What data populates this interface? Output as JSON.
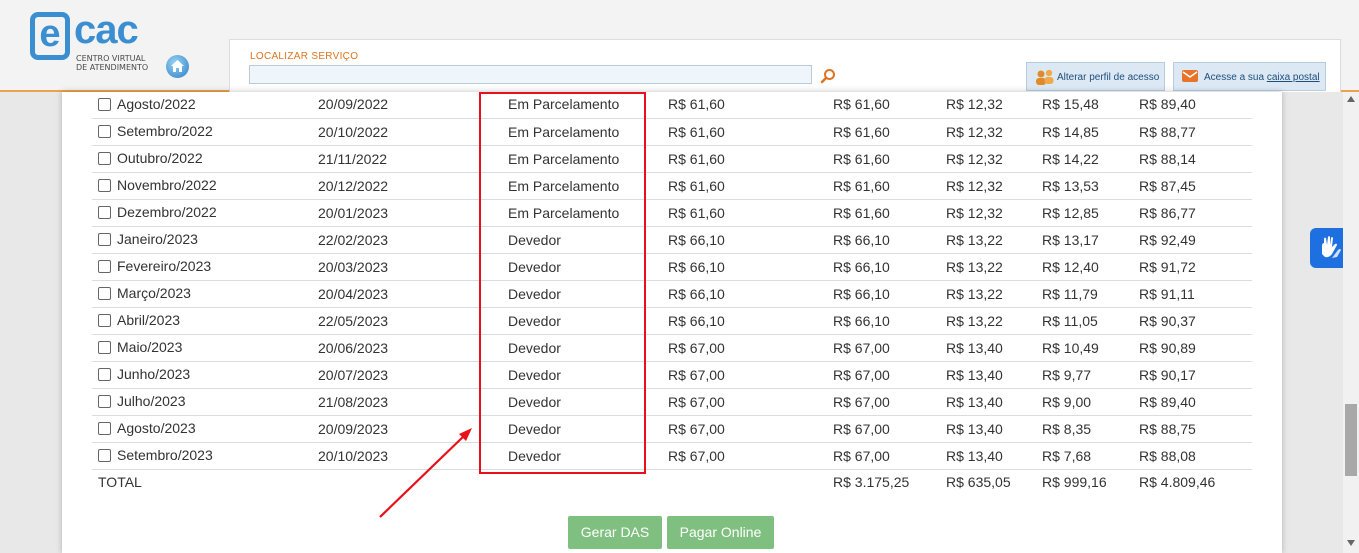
{
  "header": {
    "logo_e": "e",
    "logo_cac": "cac",
    "logo_sub1": "CENTRO VIRTUAL",
    "logo_sub2": "DE ATENDIMENTO",
    "search_label": "LOCALIZAR SERVIÇO",
    "search_value": "",
    "alterar_perfil": "Alterar perfil de acesso",
    "caixa_prefix": "Acesse a sua ",
    "caixa_link": "caixa postal",
    "icons": [
      "home-icon",
      "search-icon",
      "users-icon",
      "mail-icon"
    ]
  },
  "colors": {
    "accent": "#e0731f",
    "highlight": "#e8101a",
    "button_green": "#7fbf7f",
    "link_blue": "#1f4e79"
  },
  "table": {
    "rows": [
      {
        "period": "Agosto/2022",
        "due": "20/09/2022",
        "status": "Em Parcelamento",
        "principal": "R$ 61,60",
        "updated": "R$ 61,60",
        "fine": "R$ 12,32",
        "interest": "R$ 15,48",
        "total": "R$ 89,40"
      },
      {
        "period": "Setembro/2022",
        "due": "20/10/2022",
        "status": "Em Parcelamento",
        "principal": "R$ 61,60",
        "updated": "R$ 61,60",
        "fine": "R$ 12,32",
        "interest": "R$ 14,85",
        "total": "R$ 88,77"
      },
      {
        "period": "Outubro/2022",
        "due": "21/11/2022",
        "status": "Em Parcelamento",
        "principal": "R$ 61,60",
        "updated": "R$ 61,60",
        "fine": "R$ 12,32",
        "interest": "R$ 14,22",
        "total": "R$ 88,14"
      },
      {
        "period": "Novembro/2022",
        "due": "20/12/2022",
        "status": "Em Parcelamento",
        "principal": "R$ 61,60",
        "updated": "R$ 61,60",
        "fine": "R$ 12,32",
        "interest": "R$ 13,53",
        "total": "R$ 87,45"
      },
      {
        "period": "Dezembro/2022",
        "due": "20/01/2023",
        "status": "Em Parcelamento",
        "principal": "R$ 61,60",
        "updated": "R$ 61,60",
        "fine": "R$ 12,32",
        "interest": "R$ 12,85",
        "total": "R$ 86,77"
      },
      {
        "period": "Janeiro/2023",
        "due": "22/02/2023",
        "status": "Devedor",
        "principal": "R$ 66,10",
        "updated": "R$ 66,10",
        "fine": "R$ 13,22",
        "interest": "R$ 13,17",
        "total": "R$ 92,49"
      },
      {
        "period": "Fevereiro/2023",
        "due": "20/03/2023",
        "status": "Devedor",
        "principal": "R$ 66,10",
        "updated": "R$ 66,10",
        "fine": "R$ 13,22",
        "interest": "R$ 12,40",
        "total": "R$ 91,72"
      },
      {
        "period": "Março/2023",
        "due": "20/04/2023",
        "status": "Devedor",
        "principal": "R$ 66,10",
        "updated": "R$ 66,10",
        "fine": "R$ 13,22",
        "interest": "R$ 11,79",
        "total": "R$ 91,11"
      },
      {
        "period": "Abril/2023",
        "due": "22/05/2023",
        "status": "Devedor",
        "principal": "R$ 66,10",
        "updated": "R$ 66,10",
        "fine": "R$ 13,22",
        "interest": "R$ 11,05",
        "total": "R$ 90,37"
      },
      {
        "period": "Maio/2023",
        "due": "20/06/2023",
        "status": "Devedor",
        "principal": "R$ 67,00",
        "updated": "R$ 67,00",
        "fine": "R$ 13,40",
        "interest": "R$ 10,49",
        "total": "R$ 90,89"
      },
      {
        "period": "Junho/2023",
        "due": "20/07/2023",
        "status": "Devedor",
        "principal": "R$ 67,00",
        "updated": "R$ 67,00",
        "fine": "R$ 13,40",
        "interest": "R$ 9,77",
        "total": "R$ 90,17"
      },
      {
        "period": "Julho/2023",
        "due": "21/08/2023",
        "status": "Devedor",
        "principal": "R$ 67,00",
        "updated": "R$ 67,00",
        "fine": "R$ 13,40",
        "interest": "R$ 9,00",
        "total": "R$ 89,40"
      },
      {
        "period": "Agosto/2023",
        "due": "20/09/2023",
        "status": "Devedor",
        "principal": "R$ 67,00",
        "updated": "R$ 67,00",
        "fine": "R$ 13,40",
        "interest": "R$ 8,35",
        "total": "R$ 88,75"
      },
      {
        "period": "Setembro/2023",
        "due": "20/10/2023",
        "status": "Devedor",
        "principal": "R$ 67,00",
        "updated": "R$ 67,00",
        "fine": "R$ 13,40",
        "interest": "R$ 7,68",
        "total": "R$ 88,08"
      }
    ],
    "total": {
      "label": "TOTAL",
      "updated": "R$ 3.175,25",
      "fine": "R$ 635,05",
      "interest": "R$ 999,16",
      "total": "R$ 4.809,46"
    }
  },
  "actions": {
    "gerar_das": "Gerar DAS",
    "pagar_online": "Pagar Online"
  }
}
